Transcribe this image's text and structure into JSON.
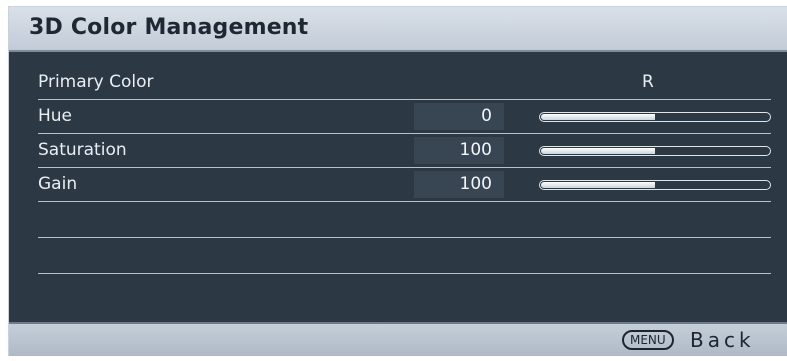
{
  "window": {
    "title": "3D Color Management"
  },
  "rows": {
    "primary": {
      "label": "Primary Color",
      "value": "R"
    },
    "hue": {
      "label": "Hue",
      "value": "0",
      "level": 0.5
    },
    "saturation": {
      "label": "Saturation",
      "value": "100",
      "level": 0.5
    },
    "gain": {
      "label": "Gain",
      "value": "100",
      "level": 0.5
    }
  },
  "footer": {
    "menu_key": "MENU",
    "back_label": "Back"
  },
  "colors": {
    "panel_bg": "#2d3845",
    "title_bg": "#c9d2dc",
    "text": "#e9eef3"
  }
}
